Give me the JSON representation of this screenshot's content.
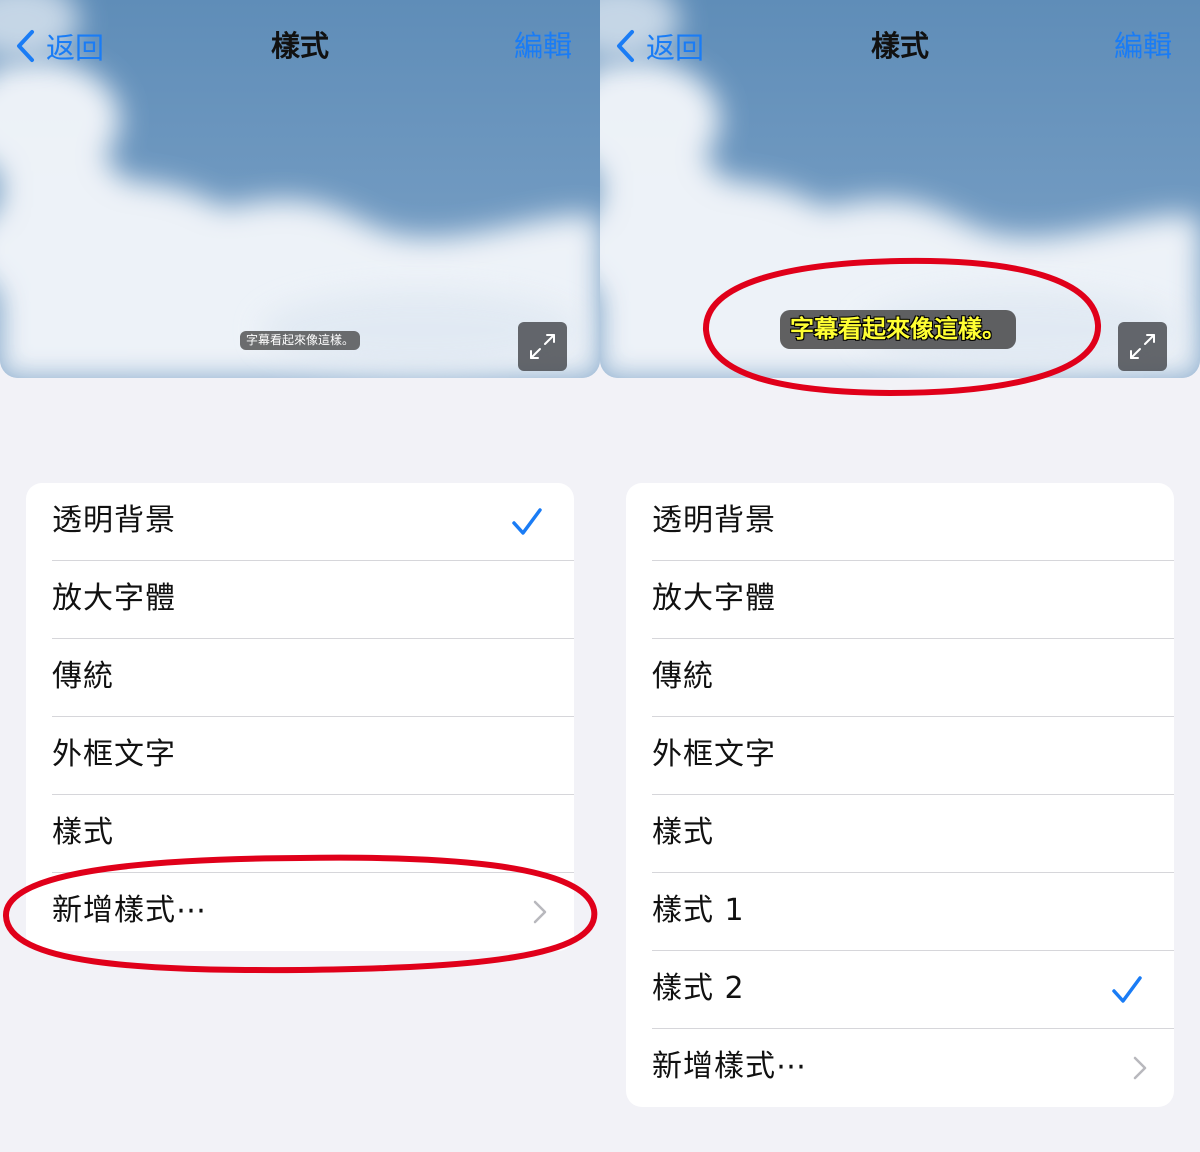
{
  "left": {
    "nav": {
      "back_label": "返回",
      "title": "樣式",
      "edit_label": "編輯"
    },
    "caption_preview": "字幕看起來像這樣。",
    "styles": [
      {
        "label": "透明背景",
        "selected": true
      },
      {
        "label": "放大字體",
        "selected": false
      },
      {
        "label": "傳統",
        "selected": false
      },
      {
        "label": "外框文字",
        "selected": false
      },
      {
        "label": "樣式",
        "selected": false
      }
    ],
    "add_style_label": "新增樣式⋯"
  },
  "right": {
    "nav": {
      "back_label": "返回",
      "title": "樣式",
      "edit_label": "編輯"
    },
    "caption_preview": "字幕看起來像這樣。",
    "styles": [
      {
        "label": "透明背景",
        "selected": false
      },
      {
        "label": "放大字體",
        "selected": false
      },
      {
        "label": "傳統",
        "selected": false
      },
      {
        "label": "外框文字",
        "selected": false
      },
      {
        "label": "樣式",
        "selected": false
      },
      {
        "label": "樣式 1",
        "selected": false
      },
      {
        "label": "樣式 2",
        "selected": true
      }
    ],
    "add_style_label": "新增樣式⋯"
  },
  "colors": {
    "accent": "#1a7cf5",
    "annotation": "#e0001a",
    "caption_large_text": "#ffff33",
    "background": "#f2f2f7"
  },
  "icons": {
    "back": "chevron-left-icon",
    "expand": "expand-arrows-icon",
    "selected": "checkmark-icon",
    "disclosure": "chevron-right-icon"
  }
}
